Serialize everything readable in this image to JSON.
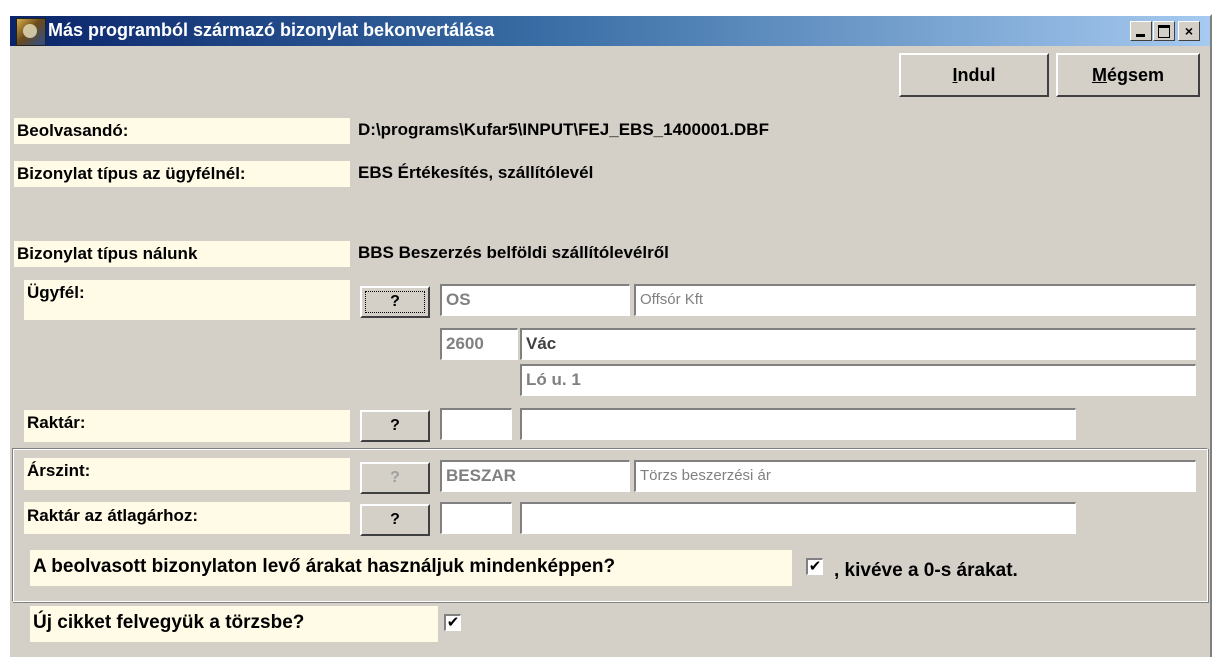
{
  "window": {
    "title": "Más programból származó bizonylat bekonvertálása",
    "buttons": {
      "minimize": "_",
      "maximize": "□",
      "close": "×"
    }
  },
  "actions": {
    "start_prefix": "",
    "start_accel": "I",
    "start_rest": "ndul",
    "cancel_prefix": "",
    "cancel_accel": "M",
    "cancel_rest": "égsem"
  },
  "info": {
    "source_label": "Beolvasandó:",
    "source_value": "D:\\programs\\Kufar5\\INPUT\\FEJ_EBS_1400001.DBF",
    "client_doc_type_label": "Bizonylat típus az ügyfélnél:",
    "client_doc_type_value": "EBS Értékesítés, szállítólevél",
    "our_doc_type_label": "Bizonylat típus nálunk",
    "our_doc_type_value": "BBS Beszerzés belföldi szállítólevélről"
  },
  "customer": {
    "label": "Ügyfél:",
    "lookup": "?",
    "code": "OS",
    "name": "Offsór Kft",
    "zip": "2600",
    "city": "Vác",
    "address": "Ló u. 1"
  },
  "warehouse": {
    "label": "Raktár:",
    "lookup": "?",
    "code": "",
    "name": ""
  },
  "price_level": {
    "label": "Árszint:",
    "lookup": "?",
    "code": "BESZAR",
    "name": "Törzs beszerzési ár"
  },
  "avg_warehouse": {
    "label": "Raktár az átlagárhoz:",
    "lookup": "?",
    "code": "",
    "name": ""
  },
  "options": {
    "use_prices_label": "A beolvasott bizonylaton levő árakat használjuk mindenképpen?",
    "use_prices_checked": "✔",
    "use_prices_suffix": ", kivéve a 0-s árakat.",
    "new_item_label": "Új cikket felvegyük a törzsbe?",
    "new_item_checked": "✔"
  }
}
